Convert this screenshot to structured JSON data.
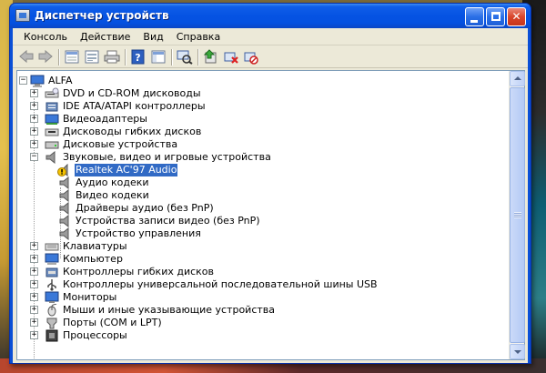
{
  "window": {
    "title": "Диспетчер устройств",
    "accent": "#0553e3"
  },
  "menu": [
    "Консоль",
    "Действие",
    "Вид",
    "Справка"
  ],
  "toolbar": [
    "back-icon",
    "forward-icon",
    "up-icon",
    "properties-icon",
    "print-icon",
    "help-icon",
    "console-tree-icon",
    "scan-hardware-icon",
    "update-driver-icon",
    "uninstall-icon",
    "disable-icon"
  ],
  "tree": {
    "root": "ALFA",
    "categories": [
      {
        "label": "DVD и CD-ROM дисководы",
        "icon": "cdrom-icon",
        "expanded": false
      },
      {
        "label": "IDE ATA/ATAPI контроллеры",
        "icon": "ide-controller-icon",
        "expanded": false
      },
      {
        "label": "Видеоадаптеры",
        "icon": "display-adapter-icon",
        "expanded": false
      },
      {
        "label": "Дисководы гибких дисков",
        "icon": "floppy-drive-icon",
        "expanded": false
      },
      {
        "label": "Дисковые устройства",
        "icon": "disk-drive-icon",
        "expanded": false
      },
      {
        "label": "Звуковые, видео и игровые устройства",
        "icon": "sound-icon",
        "expanded": true
      },
      {
        "label": "Клавиатуры",
        "icon": "keyboard-icon",
        "expanded": false
      },
      {
        "label": "Компьютер",
        "icon": "computer-icon",
        "expanded": false
      },
      {
        "label": "Контроллеры гибких дисков",
        "icon": "floppy-controller-icon",
        "expanded": false
      },
      {
        "label": "Контроллеры универсальной последовательной шины USB",
        "icon": "usb-icon",
        "expanded": false
      },
      {
        "label": "Мониторы",
        "icon": "monitor-icon",
        "expanded": false
      },
      {
        "label": "Мыши и иные указывающие устройства",
        "icon": "mouse-icon",
        "expanded": false
      },
      {
        "label": "Порты (COM и LPT)",
        "icon": "port-icon",
        "expanded": false
      },
      {
        "label": "Процессоры",
        "icon": "processor-icon",
        "expanded": false
      }
    ],
    "sound_children": [
      {
        "label": "Realtek AC'97 Audio",
        "icon": "warning-icon",
        "selected": true
      },
      {
        "label": "Аудио кодеки",
        "icon": "speaker-icon",
        "selected": false
      },
      {
        "label": "Видео кодеки",
        "icon": "speaker-icon",
        "selected": false
      },
      {
        "label": "Драйверы аудио (без PnP)",
        "icon": "speaker-icon",
        "selected": false
      },
      {
        "label": "Устройства записи видео (без PnP)",
        "icon": "speaker-icon",
        "selected": false
      },
      {
        "label": "Устройство управления",
        "icon": "speaker-icon",
        "selected": false
      }
    ]
  }
}
